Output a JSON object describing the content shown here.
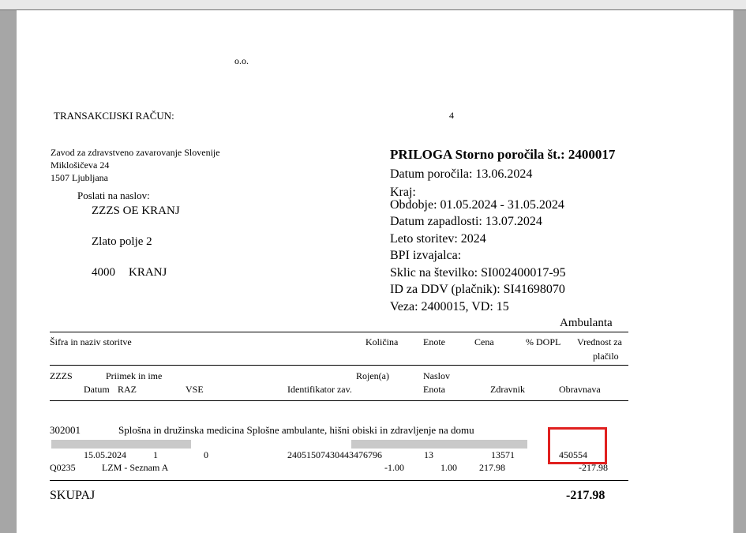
{
  "company_suffix": "o.o.",
  "bank_account_label": "TRANSAKCIJSKI RAČUN:",
  "bank_account_tail": "4",
  "recipient": {
    "line1": "Zavod za zdravstveno zavarovanje Slovenije",
    "line2": "Miklošičeva 24",
    "line3": "1507 Ljubljana"
  },
  "send_to": {
    "label": "Poslati na naslov:",
    "name": "ZZZS OE KRANJ",
    "street": "Zlato polje 2",
    "postcode": "4000",
    "city": "KRANJ"
  },
  "report": {
    "title": "PRILOGA Storno poročila št.: 2400017",
    "date": "Datum poročila: 13.06.2024",
    "place": "Kraj:",
    "period": "Obdobje: 01.05.2024 - 31.05.2024",
    "due_date": "Datum zapadlosti: 13.07.2024",
    "year": "Leto storitev:  2024",
    "bpi": "BPI izvajalca:",
    "reference": "Sklic na številko: SI002400017-95",
    "vat_id": "ID za DDV (plačnik): SI41698070",
    "link": "Veza: 2400015, VD: 15"
  },
  "section": "Ambulanta",
  "header_row1": {
    "service": "Šifra in naziv storitve",
    "quantity": "Količina",
    "unit": "Enote",
    "price": "Cena",
    "dopl": "% DOPL",
    "value_line1": "Vrednost za",
    "value_line2": "plačilo"
  },
  "header_row2": {
    "zzzs": "ZZZS",
    "name": "Priimek in ime",
    "born": "Rojen(a)",
    "address": "Naslov"
  },
  "header_row3": {
    "date": "Datum",
    "raz": "RAZ",
    "vse": "VSE",
    "identifier": "Identifikator zav.",
    "unit": "Enota",
    "doctor": "Zdravnik",
    "treatment": "Obravnava"
  },
  "service_row": {
    "code": "302001",
    "description": "Splošna in družinska medicina Splošne ambulante, hišni obiski in zdravljenje na domu"
  },
  "visit_row": {
    "date": "15.05.2024",
    "raz": "1",
    "vse": "0",
    "identifier": "24051507430443476796",
    "unit": "13",
    "doctor": "13571",
    "treatment": "450554"
  },
  "item_row": {
    "code": "Q0235",
    "name": "LZM - Seznam A",
    "quantity": "-1.00",
    "units": "1.00",
    "price": "217.98",
    "value": "-217.98"
  },
  "total": {
    "label": "SKUPAJ",
    "value": "-217.98"
  },
  "highlight_color": "#e0201f"
}
